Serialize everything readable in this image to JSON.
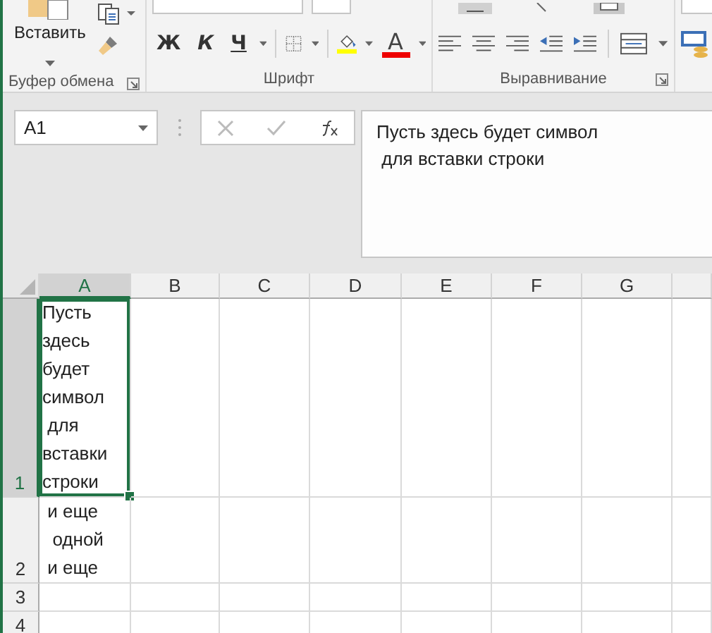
{
  "ribbon": {
    "paste_label": "Вставить",
    "groups": [
      {
        "kind": "clipboard",
        "label": "Буфер обмена"
      },
      {
        "kind": "font",
        "label": "Шрифт"
      },
      {
        "kind": "alignment",
        "label": "Выравнивание"
      },
      {
        "kind": "partial"
      }
    ],
    "font_buttons": [
      "Ж",
      "К",
      "Ч"
    ],
    "font_color_glyph": "A"
  },
  "name_box": {
    "value": "A1"
  },
  "formula_bar": {
    "value": "Пусть здесь будет символ\n для вставки строки"
  },
  "sheet": {
    "columns": [
      {
        "label": "A",
        "selected": true
      },
      {
        "label": "B",
        "selected": false
      },
      {
        "label": "C",
        "selected": false
      },
      {
        "label": "D",
        "selected": false
      },
      {
        "label": "E",
        "selected": false
      },
      {
        "label": "F",
        "selected": false
      },
      {
        "label": "G",
        "selected": false
      },
      {
        "selected": false
      }
    ],
    "rows": [
      {
        "label": "1",
        "selected": true,
        "cells": [
          {
            "text": "Пусть здесь будет символ\n для вставки строки",
            "selected": true
          }
        ]
      },
      {
        "label": "2",
        "selected": false,
        "cells": [
          {
            "text": " и еще\n  одной\n и еще",
            "selected": false
          }
        ]
      },
      {
        "label": "3",
        "selected": false,
        "cells": []
      },
      {
        "label": "4",
        "selected": false,
        "cells": []
      }
    ]
  }
}
